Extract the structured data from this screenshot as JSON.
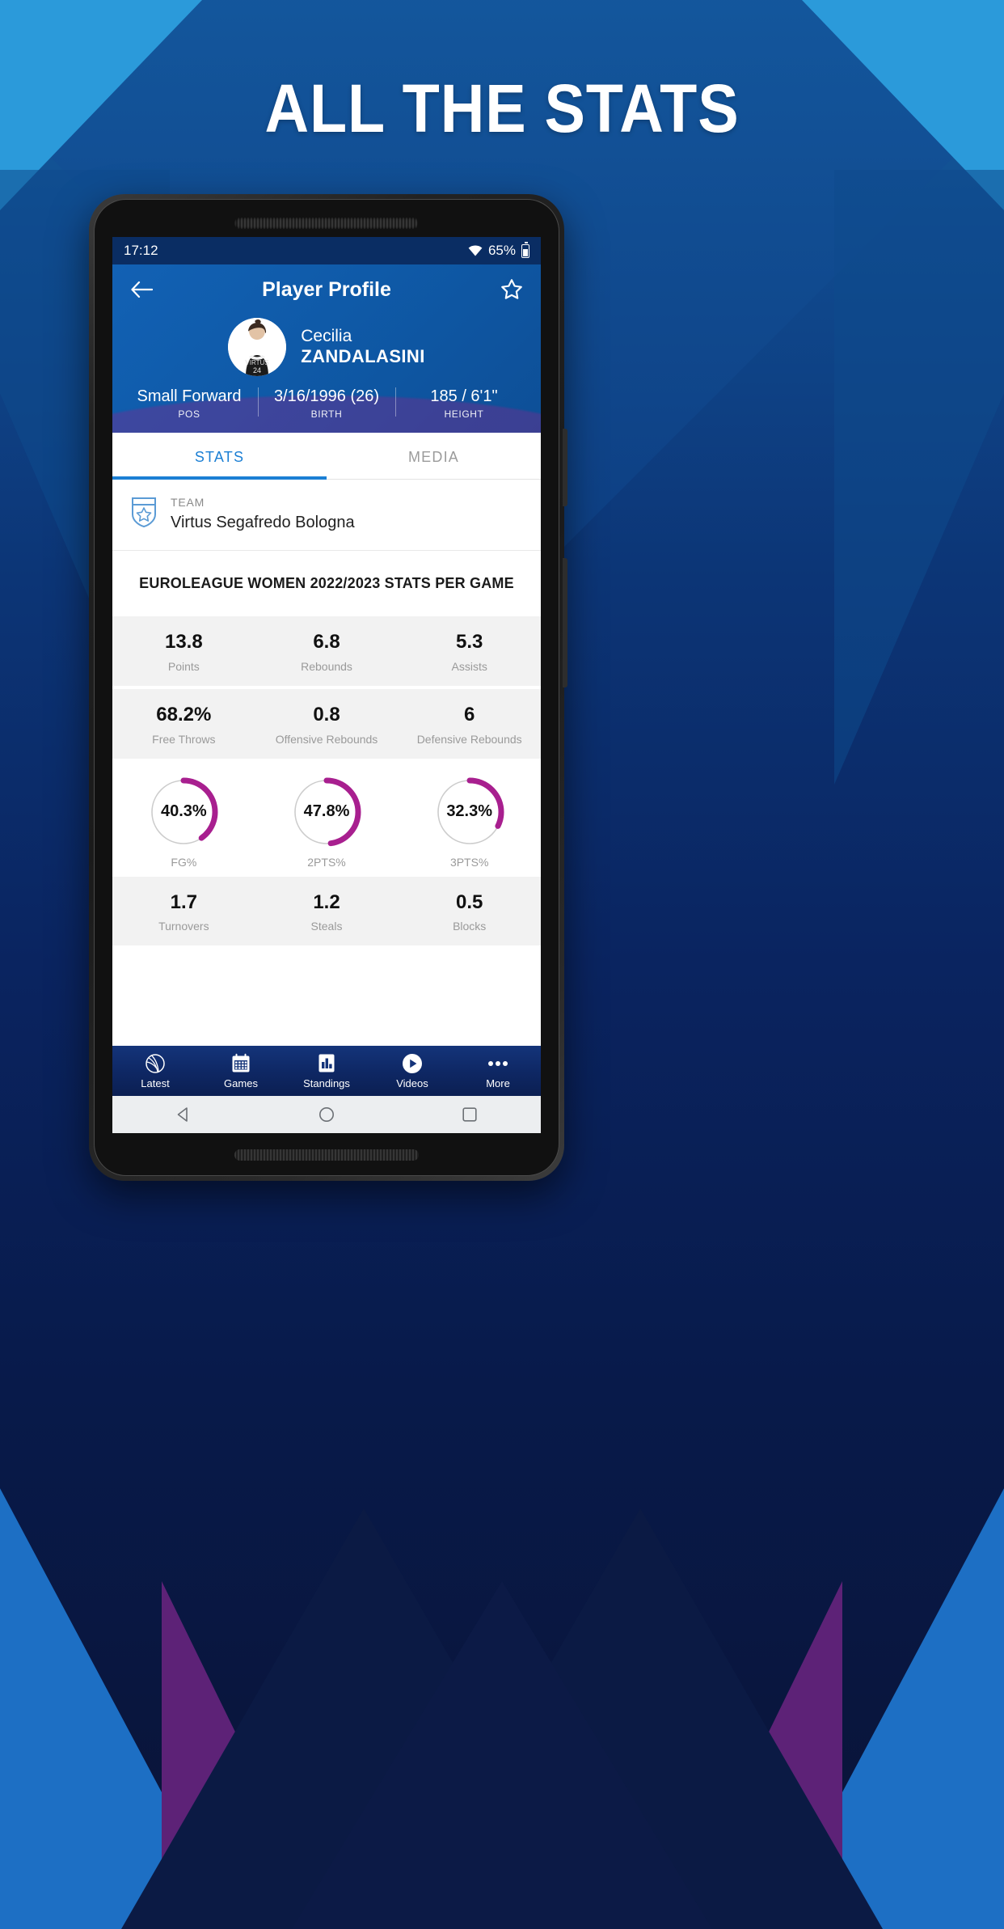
{
  "promo": {
    "headline": "ALL THE STATS"
  },
  "status_bar": {
    "time": "17:12",
    "battery_percent": "65%",
    "wifi_icon": "wifi-icon",
    "battery_icon": "battery-icon"
  },
  "header": {
    "title": "Player Profile",
    "back_icon": "back-arrow-icon",
    "favorite_icon": "star-outline-icon"
  },
  "player": {
    "first_name": "Cecilia",
    "last_name": "ZANDALASINI",
    "photo_alt": "player-photo",
    "bio": [
      {
        "value": "Small Forward",
        "label": "POS"
      },
      {
        "value": "3/16/1996 (26)",
        "label": "BIRTH"
      },
      {
        "value": "185 / 6'1\"",
        "label": "HEIGHT"
      }
    ]
  },
  "tabs": [
    {
      "label": "STATS",
      "active": true
    },
    {
      "label": "MEDIA",
      "active": false
    }
  ],
  "team": {
    "label": "TEAM",
    "name": "Virtus Segafredo Bologna",
    "logo_icon": "shield-star-icon"
  },
  "stats_title": "EUROLEAGUE WOMEN 2022/2023 STATS PER GAME",
  "chart_data": {
    "type": "table",
    "title": "EUROLEAGUE WOMEN 2022/2023 STATS PER GAME",
    "rows": [
      {
        "shaded": true,
        "cells": [
          {
            "value": "13.8",
            "label": "Points"
          },
          {
            "value": "6.8",
            "label": "Rebounds"
          },
          {
            "value": "5.3",
            "label": "Assists"
          }
        ]
      },
      {
        "shaded": true,
        "cells": [
          {
            "value": "68.2%",
            "label": "Free Throws"
          },
          {
            "value": "0.8",
            "label": "Offensive Rebounds"
          },
          {
            "value": "6",
            "label": "Defensive Rebounds"
          }
        ]
      },
      {
        "shaded": true,
        "cells": [
          {
            "value": "1.7",
            "label": "Turnovers"
          },
          {
            "value": "1.2",
            "label": "Steals"
          },
          {
            "value": "0.5",
            "label": "Blocks"
          }
        ]
      }
    ],
    "gauges": {
      "type": "pie",
      "arc_color": "#a81f8f",
      "track_color": "#cccccc",
      "items": [
        {
          "value": 40.3,
          "display": "40.3%",
          "label": "FG%"
        },
        {
          "value": 47.8,
          "display": "47.8%",
          "label": "2PTS%"
        },
        {
          "value": 32.3,
          "display": "32.3%",
          "label": "3PTS%"
        }
      ]
    }
  },
  "bottom_nav": [
    {
      "label": "Latest",
      "icon": "basketball-icon"
    },
    {
      "label": "Games",
      "icon": "calendar-icon"
    },
    {
      "label": "Standings",
      "icon": "bar-chart-icon"
    },
    {
      "label": "Videos",
      "icon": "play-circle-icon"
    },
    {
      "label": "More",
      "icon": "ellipsis-icon"
    }
  ],
  "system_nav": [
    {
      "icon": "android-back-icon"
    },
    {
      "icon": "android-home-icon"
    },
    {
      "icon": "android-recents-icon"
    }
  ],
  "colors": {
    "accent_blue": "#1b7fd4",
    "header_blue": "#0f5aa8",
    "nav_blue": "#0e2763",
    "gauge_magenta": "#a81f8f"
  }
}
